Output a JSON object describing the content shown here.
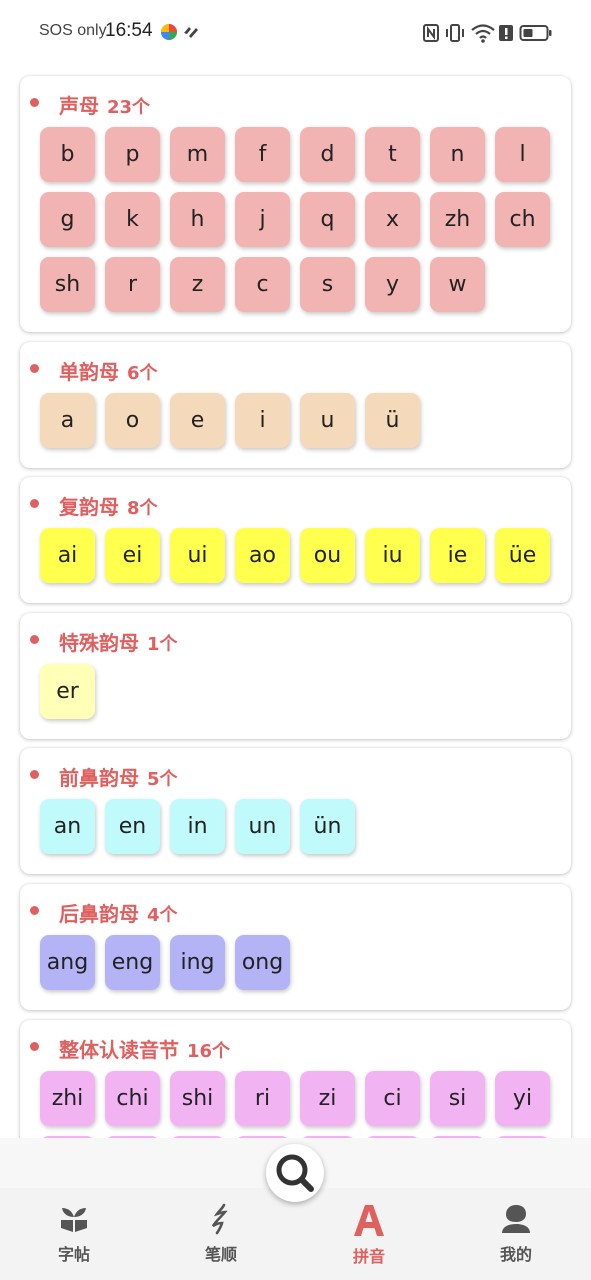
{
  "status_bar": {
    "carrier": "SOS only",
    "time": "16:54"
  },
  "sections": [
    {
      "title": "声母",
      "count": "23个",
      "color": "#f2b3b3",
      "items": [
        "b",
        "p",
        "m",
        "f",
        "d",
        "t",
        "n",
        "l",
        "g",
        "k",
        "h",
        "j",
        "q",
        "x",
        "zh",
        "ch",
        "sh",
        "r",
        "z",
        "c",
        "s",
        "y",
        "w"
      ]
    },
    {
      "title": "单韵母",
      "count": "6个",
      "color": "#f5d9bb",
      "items": [
        "a",
        "o",
        "e",
        "i",
        "u",
        "ü"
      ]
    },
    {
      "title": "复韵母",
      "count": "8个",
      "color": "#ffff4d",
      "items": [
        "ai",
        "ei",
        "ui",
        "ao",
        "ou",
        "iu",
        "ie",
        "üe"
      ]
    },
    {
      "title": "特殊韵母",
      "count": "1个",
      "color": "#ffffb8",
      "items": [
        "er"
      ]
    },
    {
      "title": "前鼻韵母",
      "count": "5个",
      "color": "#c0fafa",
      "items": [
        "an",
        "en",
        "in",
        "un",
        "ün"
      ]
    },
    {
      "title": "后鼻韵母",
      "count": "4个",
      "color": "#b3b3f5",
      "items": [
        "ang",
        "eng",
        "ing",
        "ong"
      ]
    },
    {
      "title": "整体认读音节",
      "count": "16个",
      "color": "#f2b3f2",
      "items": [
        "zhi",
        "chi",
        "shi",
        "ri",
        "zi",
        "ci",
        "si",
        "yi",
        "",
        "",
        "",
        "",
        "",
        "",
        "",
        ""
      ]
    }
  ],
  "tabbar": {
    "tabs": [
      {
        "label": "字帖",
        "icon": "copybook-icon",
        "active": false
      },
      {
        "label": "笔顺",
        "icon": "stroke-order-icon",
        "active": false
      },
      {
        "label": "拼音",
        "icon": "pinyin-icon",
        "active": true
      },
      {
        "label": "我的",
        "icon": "profile-icon",
        "active": false
      }
    ],
    "search_icon": "search-icon"
  },
  "colors": {
    "accent": "#e06060",
    "tab_inactive": "#555555"
  }
}
